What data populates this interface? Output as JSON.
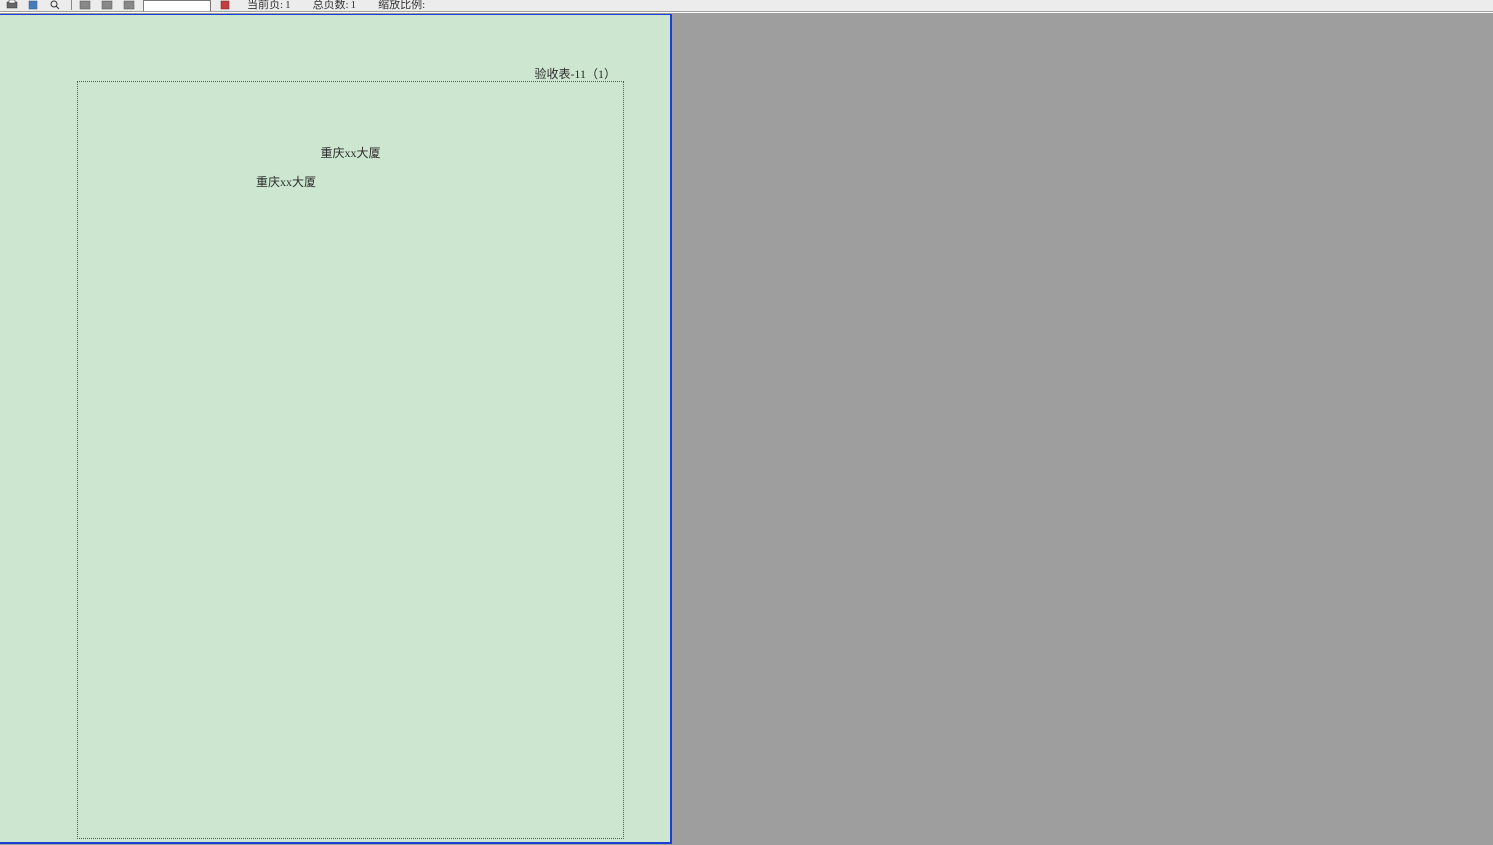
{
  "toolbar": {
    "zoom_value": "",
    "current_page_label": "当前页:",
    "current_page_value": "1",
    "total_pages_label": "总页数:",
    "total_pages_value": "1",
    "zoom_ratio_label": "缩放比例:",
    "zoom_ratio_value": ""
  },
  "document": {
    "header_label": "验收表-11（1）",
    "title": "重庆xx大厦",
    "subtitle": "重庆xx大厦"
  }
}
